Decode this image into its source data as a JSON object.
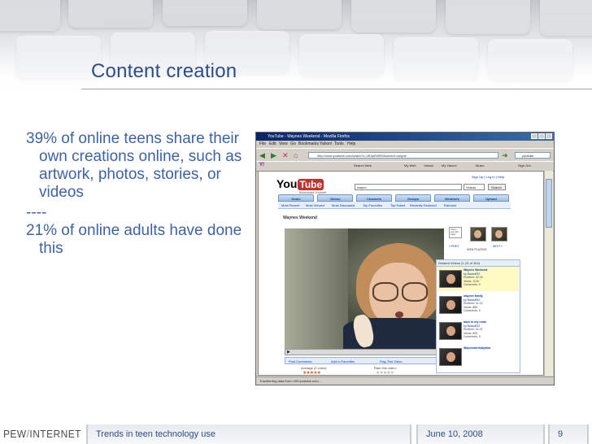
{
  "slide": {
    "title": "Content creation",
    "bullets": [
      "39% of online teens share their own creations online, such as artwork, photos, stories, or videos",
      "----",
      "21% of online adults have done this"
    ]
  },
  "screenshot": {
    "window_title": "YouTube - Waynes Weekend - Mozilla Firefox",
    "menu": [
      "File",
      "Edit",
      "View",
      "Go",
      "Bookmarks",
      "Yahoo!",
      "Tools",
      "Help"
    ],
    "url": "http://www.youtube.com/watch?v=2K8pRr5R0&search=wayne",
    "search_engine": "youtube",
    "yahoo_items": [
      "Y!",
      "Search Web",
      "My Web",
      "Yahoo!",
      "My Yahoo!",
      "Music",
      "Sign Out"
    ],
    "logo_you": "You",
    "logo_tube": "Tube",
    "tagline": "Broadcast Yourself",
    "top_links": "Sign Up | Log In | Help",
    "search_value": "wayne",
    "search_type": "Videos",
    "search_button": "Search",
    "tabs": [
      "Home",
      "Videos",
      "Channels",
      "Groups",
      "Members",
      "Upload"
    ],
    "subnav": [
      "Most Recent",
      "Most Viewed",
      "Most Discussed",
      "Top Favorites",
      "Top Rated",
      "Recently Featured",
      "Random"
    ],
    "video_title": "Waynes Weekend",
    "player_controls": "▶",
    "actions": [
      "Post Comments",
      "Add to Favorites",
      "Flag This Video"
    ],
    "rating_label": "Average (2 votes)",
    "rate_label": "Rate this video!",
    "panel": {
      "prev": "« PREV",
      "now": "NOW PLAYING",
      "next": "NEXT »",
      "note": "This is your first video"
    },
    "related_header": "Related Videos (1-20 of 304)",
    "related": [
      {
        "title": "Waynes Weekend",
        "by": "by Bassoff32",
        "runtime": "Runtime: 02:32",
        "views": "Views: 1128",
        "comments": "Comments: 0"
      },
      {
        "title": "waynes family",
        "by": "by Bassoff32",
        "runtime": "Runtime: 01:22",
        "views": "Views: 885",
        "comments": "Comments: 0"
      },
      {
        "title": "back to my roots",
        "by": "by Bassoff32",
        "runtime": "Runtime: 01:37",
        "views": "Views: 605",
        "comments": "Comments: 0"
      },
      {
        "title": "Waynesbirthdaytrial",
        "by": "",
        "runtime": "",
        "views": "",
        "comments": ""
      }
    ],
    "status": "Transferring data from r150.youtube.com..."
  },
  "footer": {
    "logo_left": "PEW",
    "logo_slash": "/",
    "logo_right": "INTERNET",
    "caption": "Trends in teen technology use",
    "date": "June 10, 2008",
    "page": "9"
  },
  "colors": {
    "title": "#2c4d8c",
    "bullets": "#3d62a8",
    "youtube_red": "#c4302b"
  }
}
